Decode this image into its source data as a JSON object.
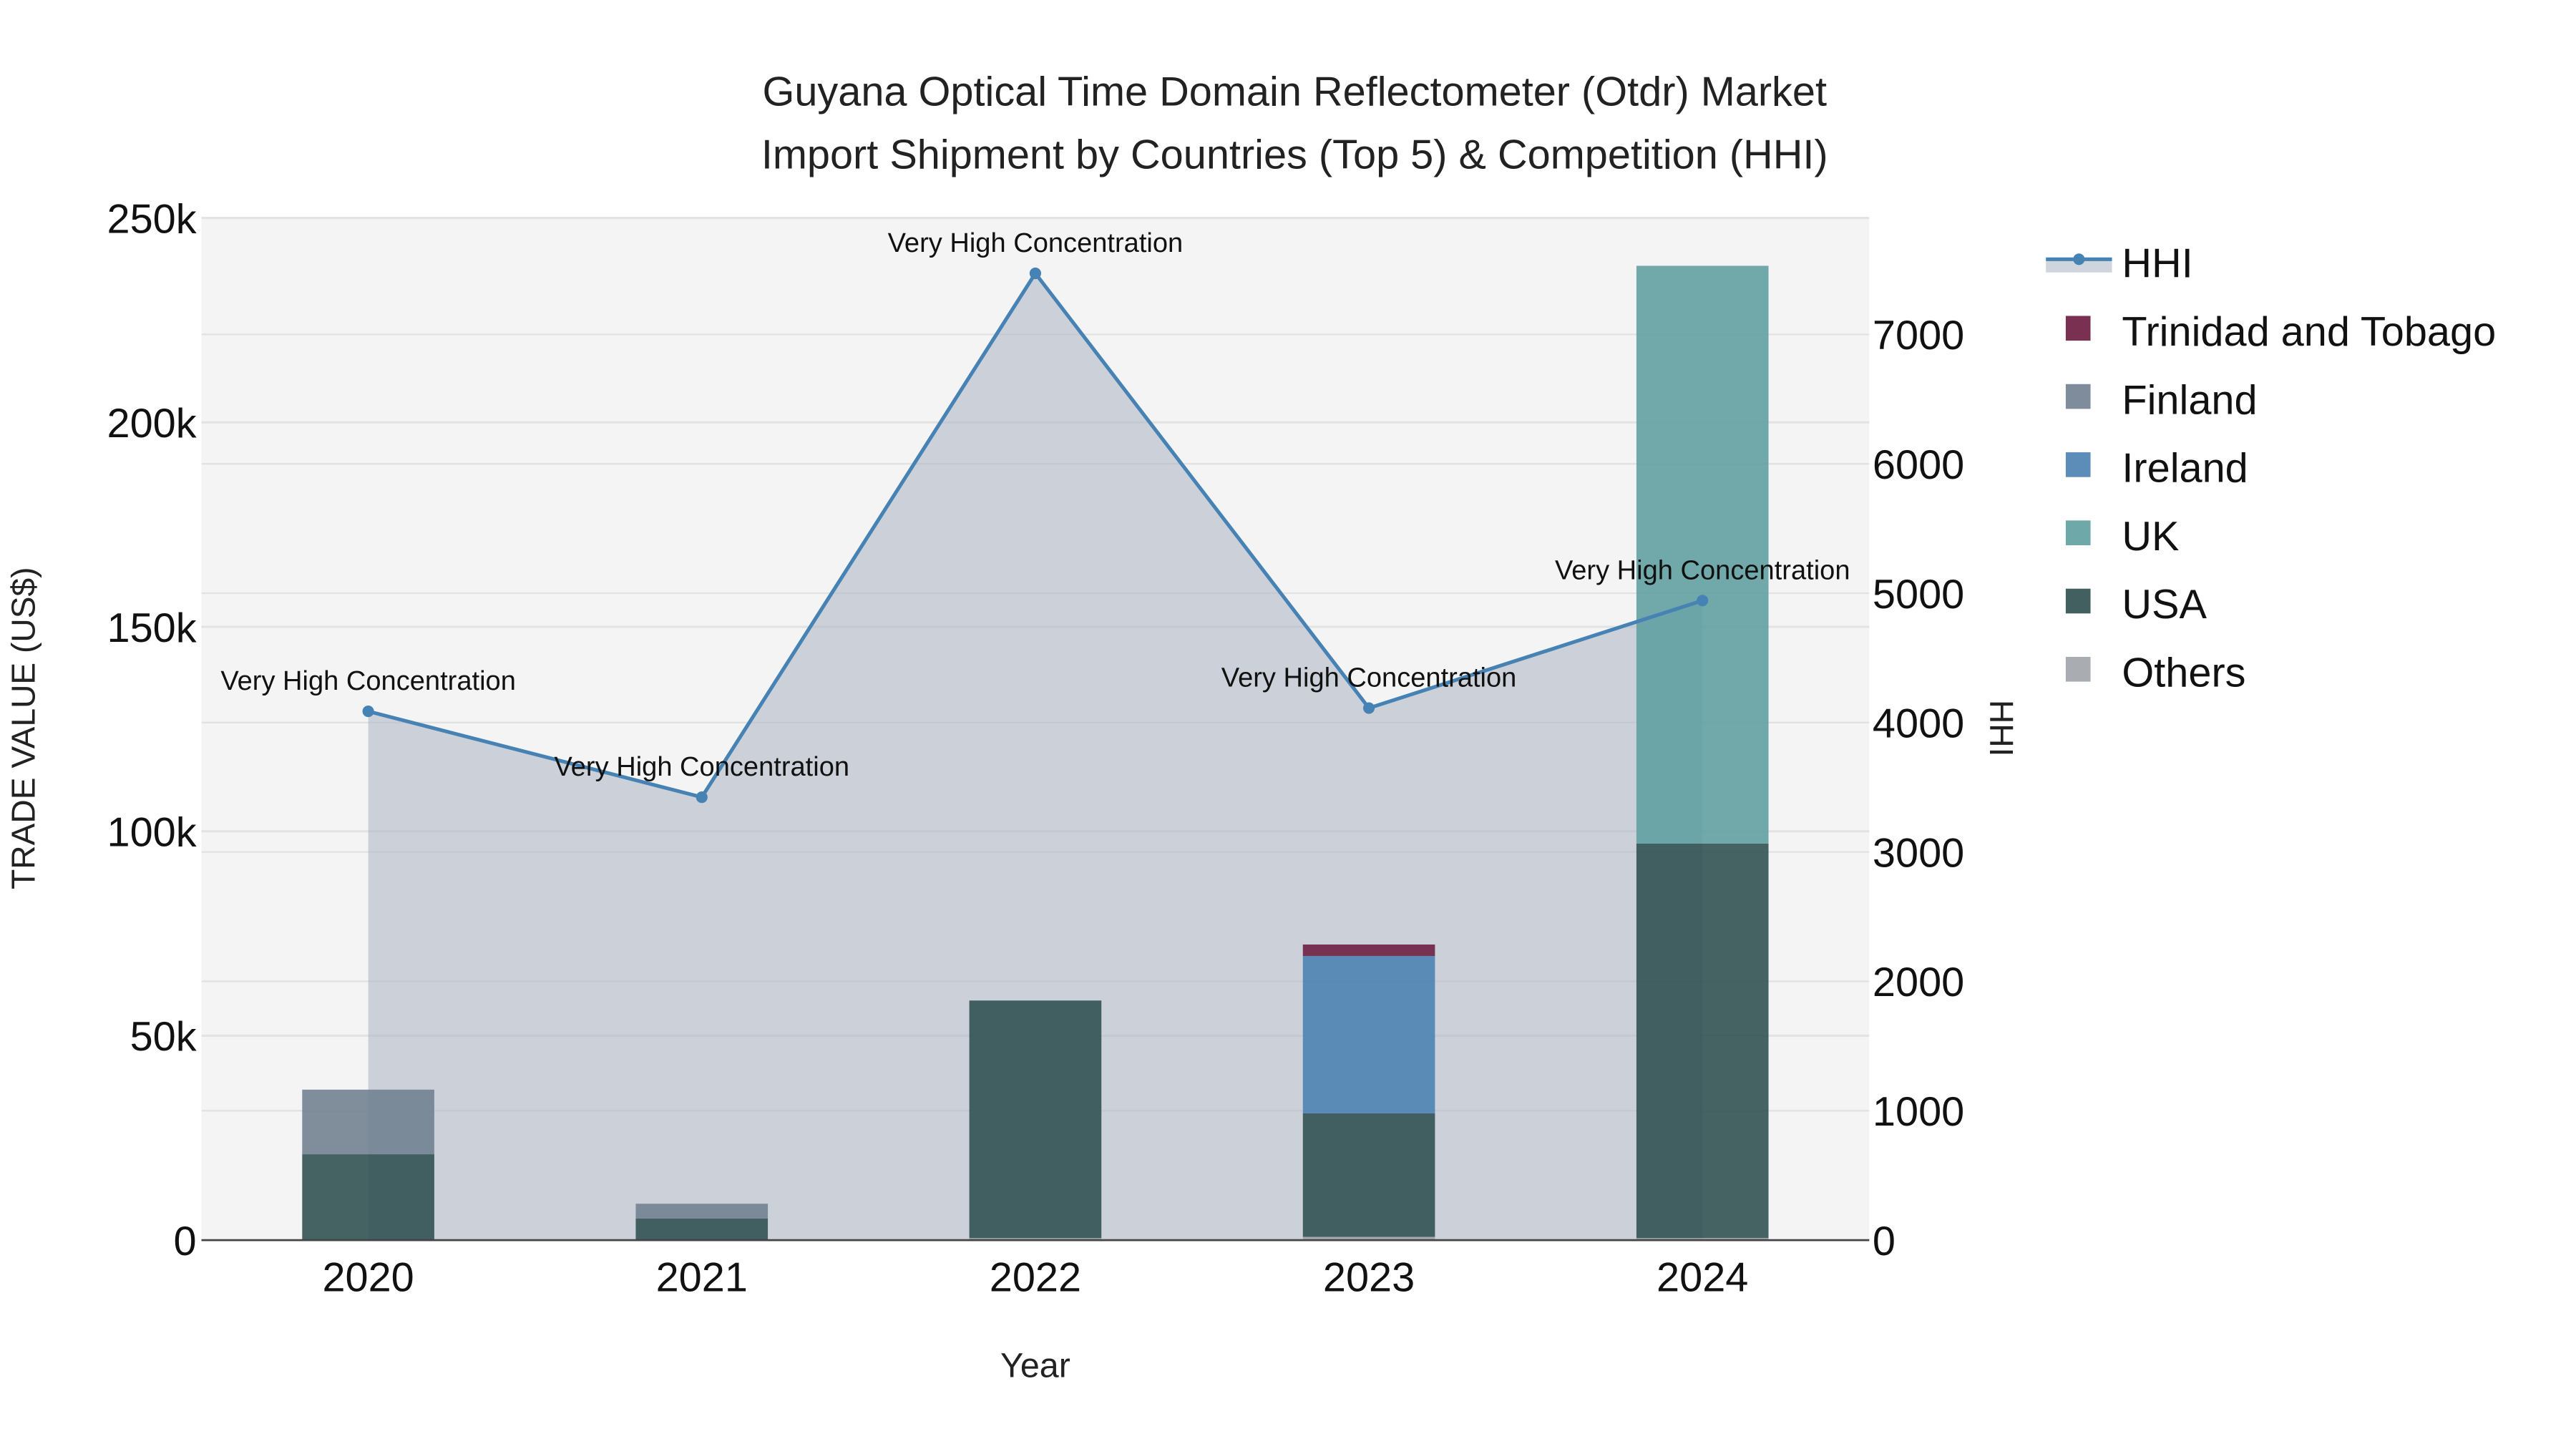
{
  "chart_data": {
    "type": "bar",
    "title_line1": "Guyana Optical Time Domain Reflectometer (Otdr) Market",
    "title_line2": "Import Shipment by Countries (Top 5) & Competition (HHI)",
    "xlabel": "Year",
    "ylabel": "TRADE VALUE (US$)",
    "y2label": "HHI",
    "categories": [
      "2020",
      "2021",
      "2022",
      "2023",
      "2024"
    ],
    "ylim": [
      0,
      250000
    ],
    "y_ticks": [
      0,
      50000,
      100000,
      150000,
      200000,
      250000
    ],
    "y_tick_labels": [
      "0",
      "50k",
      "100k",
      "150k",
      "200k",
      "250k"
    ],
    "y2lim": [
      0,
      7900
    ],
    "y2_ticks": [
      0,
      1000,
      2000,
      3000,
      4000,
      5000,
      6000,
      7000
    ],
    "y2_tick_labels": [
      "0",
      "1000",
      "2000",
      "3000",
      "4000",
      "5000",
      "6000",
      "7000"
    ],
    "grid": true,
    "legend_position": "right",
    "series": [
      {
        "name": "Others",
        "color": "#a0a3a8",
        "values": [
          0,
          0,
          500,
          800,
          500
        ]
      },
      {
        "name": "USA",
        "color": "#2e4f4f",
        "values": [
          21000,
          5300,
          58100,
          30200,
          96500
        ]
      },
      {
        "name": "UK",
        "color": "#5f9ea0",
        "values": [
          0,
          0,
          0,
          0,
          141300
        ]
      },
      {
        "name": "Ireland",
        "color": "#4a7fb0",
        "values": [
          0,
          0,
          0,
          38500,
          0
        ]
      },
      {
        "name": "Finland",
        "color": "#708090",
        "values": [
          15800,
          3600,
          0,
          0,
          0
        ]
      },
      {
        "name": "Trinidad and Tobago",
        "color": "#6b1a3e",
        "values": [
          0,
          0,
          0,
          2800,
          0
        ]
      }
    ],
    "hhi": {
      "name": "HHI",
      "color": "#4682b4",
      "values": [
        4087,
        3423,
        7472,
        4112,
        4943
      ],
      "annotations": [
        "Very High Concentration",
        "Very High Concentration",
        "Very High Concentration",
        "Very High Concentration",
        "Very High Concentration"
      ]
    },
    "legend_order": [
      "HHI",
      "Trinidad and Tobago",
      "Finland",
      "Ireland",
      "UK",
      "USA",
      "Others"
    ]
  }
}
